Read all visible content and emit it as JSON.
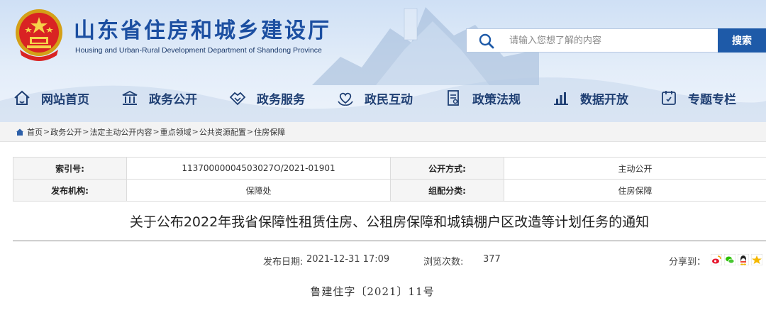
{
  "header": {
    "title": "山东省住房和城乡建设厅",
    "subtitle": "Housing and Urban-Rural Development Department of Shandong Province"
  },
  "search": {
    "placeholder": "请输入您想了解的内容",
    "button_label": "搜索"
  },
  "nav": {
    "items": [
      {
        "label": "网站首页",
        "icon": "home-icon"
      },
      {
        "label": "政务公开",
        "icon": "government-building-icon"
      },
      {
        "label": "政务服务",
        "icon": "handshake-icon"
      },
      {
        "label": "政民互动",
        "icon": "heart-hands-icon"
      },
      {
        "label": "政策法规",
        "icon": "document-icon"
      },
      {
        "label": "数据开放",
        "icon": "bar-chart-icon"
      },
      {
        "label": "专题专栏",
        "icon": "topic-icon"
      }
    ]
  },
  "breadcrumb": {
    "items": [
      "首页",
      "政务公开",
      "法定主动公开内容",
      "重点领域",
      "公共资源配置",
      "住房保障"
    ],
    "separator": ">"
  },
  "info": {
    "index_label": "索引号:",
    "index_value": "11370000004503027O/2021-01901",
    "disclosure_label": "公开方式:",
    "disclosure_value": "主动公开",
    "issuer_label": "发布机构:",
    "issuer_value": "保障处",
    "category_label": "组配分类:",
    "category_value": "住房保障"
  },
  "article": {
    "title": "关于公布2022年我省保障性租赁住房、公租房保障和城镇棚户区改造等计划任务的通知",
    "publish_date_label": "发布日期:",
    "publish_date": "2021-12-31 17:09",
    "views_label": "浏览次数:",
    "views": "377",
    "share_label": "分享到：",
    "share_icons": [
      "weibo-icon",
      "wechat-icon",
      "qq-icon",
      "qzone-icon"
    ],
    "doc_number": "鲁建住字〔2021〕11号"
  },
  "colors": {
    "brand_blue": "#1c4fa1",
    "nav_text": "#1f3f73",
    "search_button": "#1e5aa8"
  }
}
